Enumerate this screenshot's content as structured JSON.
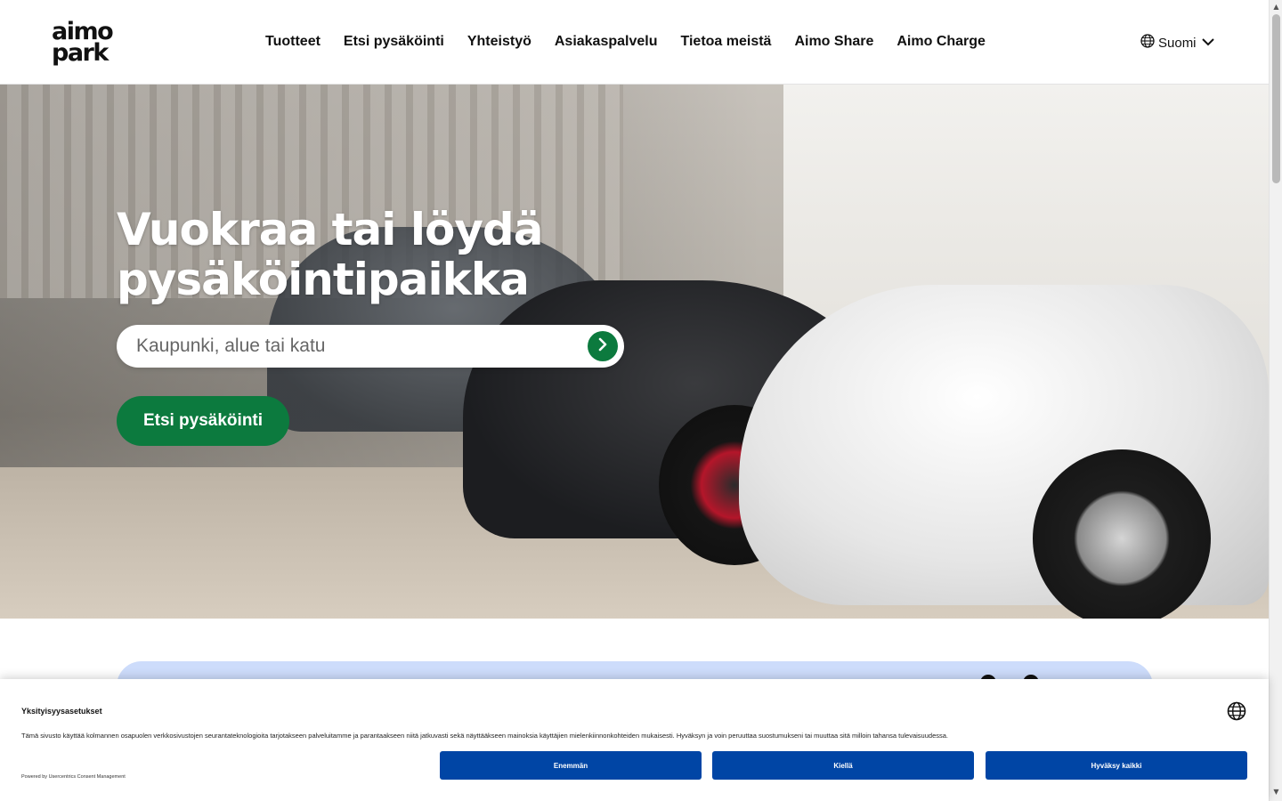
{
  "header": {
    "logo_line1": "aimo",
    "logo_line2": "park",
    "nav": [
      {
        "label": "Tuotteet"
      },
      {
        "label": "Etsi pysäköinti"
      },
      {
        "label": "Yhteistyö"
      },
      {
        "label": "Asiakaspalvelu"
      },
      {
        "label": "Tietoa meistä"
      },
      {
        "label": "Aimo Share"
      },
      {
        "label": "Aimo Charge"
      }
    ],
    "language": {
      "label": "Suomi",
      "icon": "globe-icon"
    }
  },
  "hero": {
    "title": "Vuokraa tai löydä pysäköintipaikka",
    "search_placeholder": "Kaupunki, alue tai katu",
    "search_icon": "arrow-right-icon",
    "cta_label": "Etsi pysäköinti"
  },
  "consent": {
    "title": "Yksityisyysasetukset",
    "text": "Tämä sivusto käyttää kolmannen osapuolen verkkosivustojen seurantateknologioita tarjotakseen palveluitamme ja parantaakseen niitä jatkuvasti sekä näyttääkseen mainoksia käyttäjien mielenkiinnonkohteiden mukaisesti. Hyväksyn ja voin peruuttaa suostumukseni tai muuttaa sitä milloin tahansa tulevaisuudessa.",
    "powered_by": "Powered by Usercentrics Consent Management",
    "buttons": {
      "more": "Enemmän",
      "deny": "Kiellä",
      "accept_all": "Hyväksy kaikki"
    }
  },
  "colors": {
    "brand_green": "#0c7a3e",
    "consent_blue": "#0045a5",
    "promo_blue": "#cddcfb"
  }
}
